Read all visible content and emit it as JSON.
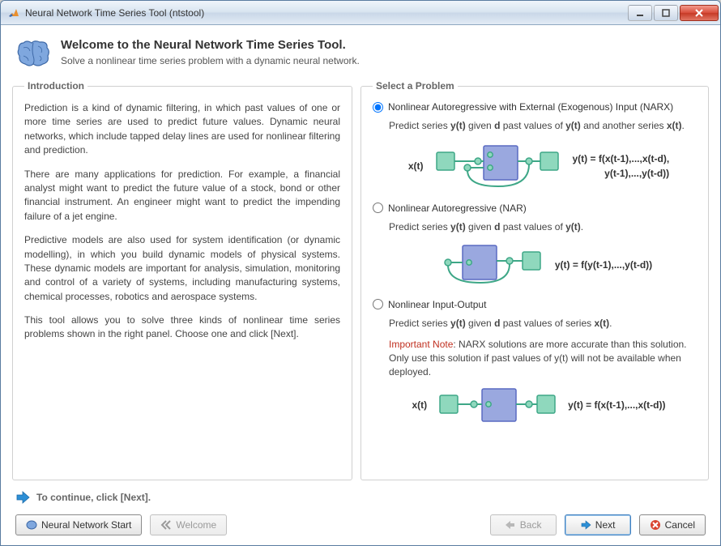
{
  "window": {
    "title": "Neural Network Time Series Tool (ntstool)"
  },
  "header": {
    "title": "Welcome to the Neural Network Time Series Tool.",
    "subtitle": "Solve a nonlinear time series problem with a dynamic neural network."
  },
  "intro": {
    "legend": "Introduction",
    "p1": "Prediction is a kind of dynamic filtering, in which past values of one or more time series are used to predict future values. Dynamic neural networks, which include tapped delay lines are used for nonlinear filtering and prediction.",
    "p2": "There are many applications for prediction. For example, a financial analyst might want to predict the future value of a stock, bond or other financial instrument. An engineer might want to predict the impending failure of a jet engine.",
    "p3": "Predictive models are also used for system identification (or dynamic modelling), in which you build dynamic models of physical systems. These dynamic models are important for analysis, simulation, monitoring and control of a variety of systems, including manufacturing systems, chemical processes, robotics and aerospace systems.",
    "p4": "This tool allows you to solve three kinds of nonlinear time series problems shown in the right panel. Choose one and click [Next]."
  },
  "select": {
    "legend": "Select a Problem",
    "narx": {
      "label": "Nonlinear Autoregressive with External (Exogenous) Input (NARX)",
      "desc_pre": "Predict series ",
      "desc_yt": "y(t)",
      "desc_mid1": " given ",
      "desc_d": "d",
      "desc_mid2": " past values of ",
      "desc_mid3": " and another series ",
      "desc_xt": "x(t)",
      "desc_end": ".",
      "eqn_l1": "y(t) = f(x(t-1),...,x(t-d),",
      "eqn_l2": "y(t-1),...,y(t-d))",
      "prelabel": "x(t)"
    },
    "nar": {
      "label": "Nonlinear Autoregressive (NAR)",
      "desc_pre": "Predict series ",
      "desc_yt": "y(t)",
      "desc_mid1": " given ",
      "desc_d": "d",
      "desc_mid2": " past values of ",
      "desc_end": ".",
      "eqn": "y(t) = f(y(t-1),...,y(t-d))"
    },
    "nio": {
      "label": "Nonlinear Input-Output",
      "desc_pre": "Predict series ",
      "desc_yt": "y(t)",
      "desc_mid1": " given ",
      "desc_d": "d",
      "desc_mid2": " past values of series ",
      "desc_xt": "x(t)",
      "desc_end": ".",
      "note_label": "Important Note",
      "note_text": ": NARX solutions are more accurate than this solution. Only use this solution if past values of y(t) will not be available when deployed.",
      "eqn": "y(t) = f(x(t-1),...,x(t-d))",
      "prelabel": "x(t)"
    }
  },
  "footer_hint": "To continue, click [Next].",
  "buttons": {
    "nnstart": "Neural Network Start",
    "welcome": "Welcome",
    "back": "Back",
    "next": "Next",
    "cancel": "Cancel"
  }
}
